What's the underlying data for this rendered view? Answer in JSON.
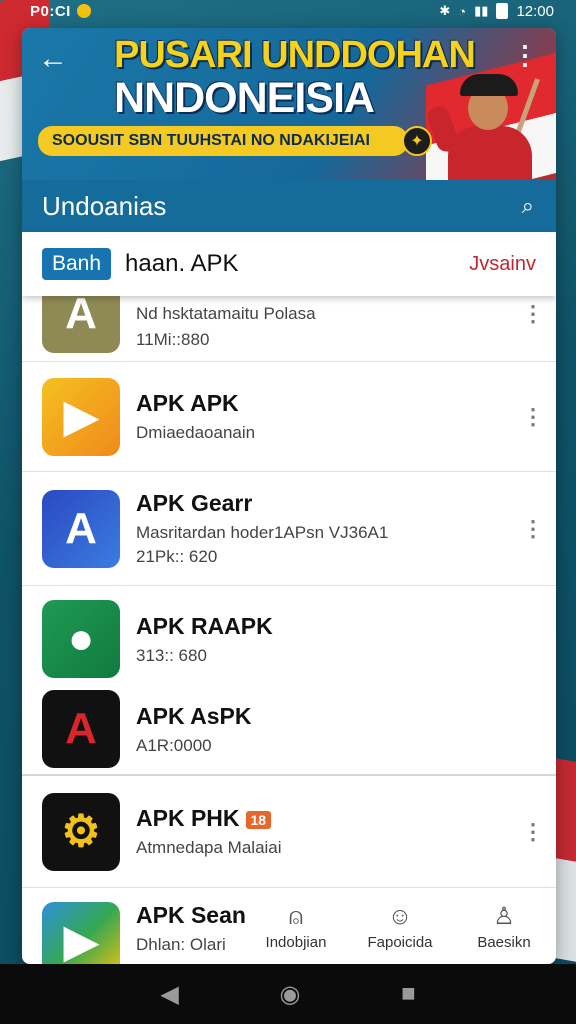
{
  "status_bar": {
    "carrier": "P0:CI",
    "time": "12:00"
  },
  "banner": {
    "title_line1": "PUSARI UNDDOHAN",
    "title_line2": "NNDONEISIA",
    "strip_text": "SOOUSIT SBN TUUHSTAI NO NDAKIJEIAI"
  },
  "title_bar": {
    "title": "Undoanias"
  },
  "search": {
    "chip": "Banh",
    "query": "haan. APK",
    "action": "Jvsainv"
  },
  "apps": [
    {
      "name": "Nd hsktatamaitu Polasa",
      "sub": "11Mi::880",
      "sub2": "",
      "badge": ""
    },
    {
      "name": "APK APK",
      "sub": "Dmiaedaoanain",
      "sub2": "",
      "badge": ""
    },
    {
      "name": "APK Gearr",
      "sub": "Masritardan hoder1APsn VJ36A1",
      "sub2": "21Pk:: 620",
      "badge": ""
    },
    {
      "name": "APK RAAPK",
      "sub": "313:: 680",
      "sub2": "",
      "badge": ""
    },
    {
      "name": "APK AsPK",
      "sub": "A1R:0000",
      "sub2": "",
      "badge": ""
    },
    {
      "name": "APK PHK",
      "sub": "Atmnedapa Malaiai",
      "sub2": "",
      "badge": "18"
    },
    {
      "name": "APK Sean",
      "sub": "Dhlan: Olari",
      "sub2": "",
      "badge": ""
    }
  ],
  "bottom_tabs": [
    {
      "label": "Indobjian",
      "icon": "bell-icon"
    },
    {
      "label": "Fapoicida",
      "icon": "user-icon"
    },
    {
      "label": "Baesikn",
      "icon": "account-icon"
    }
  ],
  "colors": {
    "primary": "#156b9a",
    "accent_red": "#c0282d",
    "banner_yellow": "#f6d21a"
  }
}
